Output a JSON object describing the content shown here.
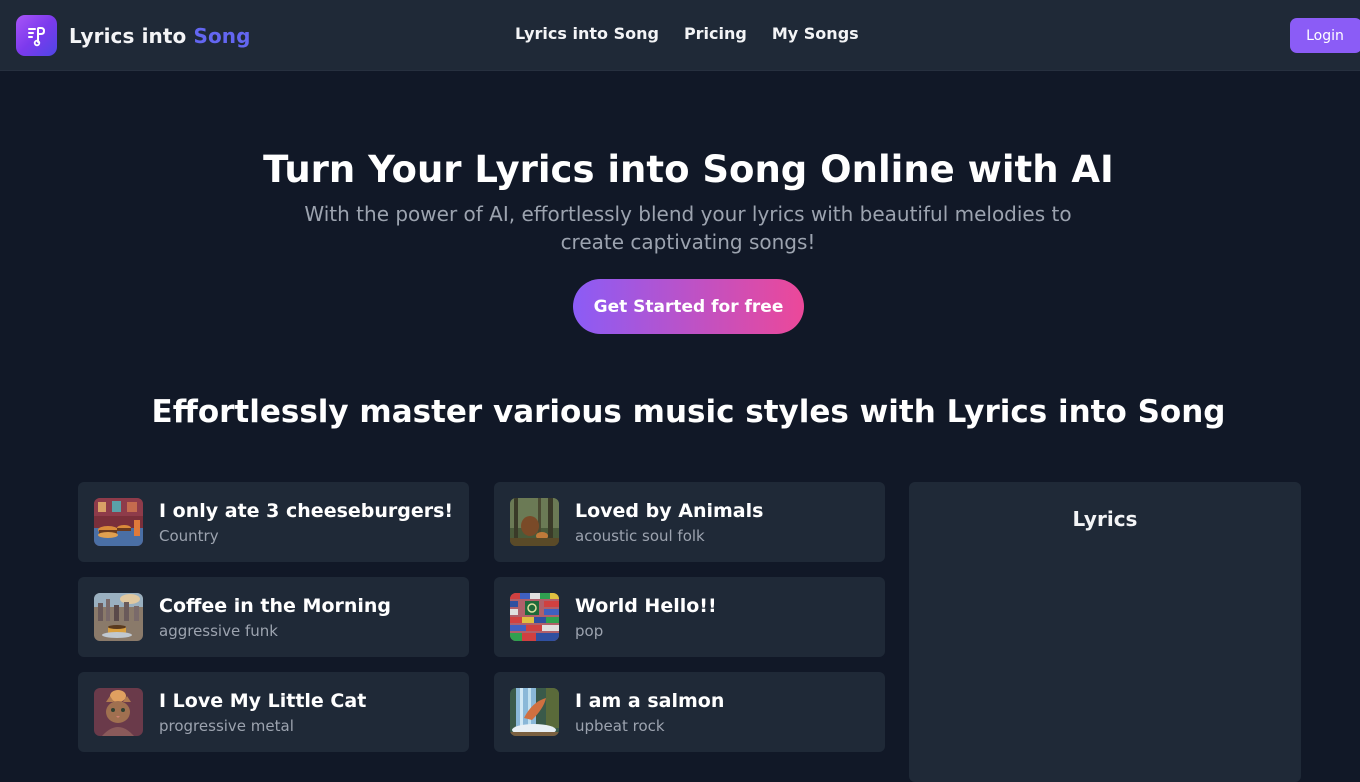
{
  "header": {
    "brand_main": "Lyrics into ",
    "brand_accent": "Song",
    "logo_icon": "music-list-icon",
    "nav": [
      {
        "label": "Lyrics into Song"
      },
      {
        "label": "Pricing"
      },
      {
        "label": "My Songs"
      }
    ],
    "login_label": "Login"
  },
  "hero": {
    "title": "Turn Your Lyrics into Song Online with AI",
    "subtitle": "With the power of AI, effortlessly blend your lyrics with beautiful melodies to create captivating songs!",
    "cta_label": "Get Started for free"
  },
  "styles_section": {
    "title": "Effortlessly master various music styles with Lyrics into Song",
    "songs": [
      {
        "title": "I only ate 3 cheeseburgers!",
        "style": "Country",
        "thumb": "diner-burgers"
      },
      {
        "title": "Loved by Animals",
        "style": "acoustic soul folk",
        "thumb": "forest-animals"
      },
      {
        "title": "Coffee in the Morning",
        "style": "aggressive funk",
        "thumb": "coffee-city"
      },
      {
        "title": "World Hello!!",
        "style": "pop",
        "thumb": "world-flags"
      },
      {
        "title": "I Love My Little Cat",
        "style": "progressive metal",
        "thumb": "cat-portrait"
      },
      {
        "title": "I am a salmon",
        "style": "upbeat rock",
        "thumb": "salmon-waterfall"
      }
    ],
    "lyrics_panel_title": "Lyrics"
  },
  "colors": {
    "background": "#111827",
    "surface": "#1f2937",
    "brand_accent": "#6366f1",
    "login_button": "#8b5cf6",
    "cta_gradient_start": "#8b5cf6",
    "cta_gradient_end": "#ec4899",
    "muted_text": "#9ca3af"
  }
}
